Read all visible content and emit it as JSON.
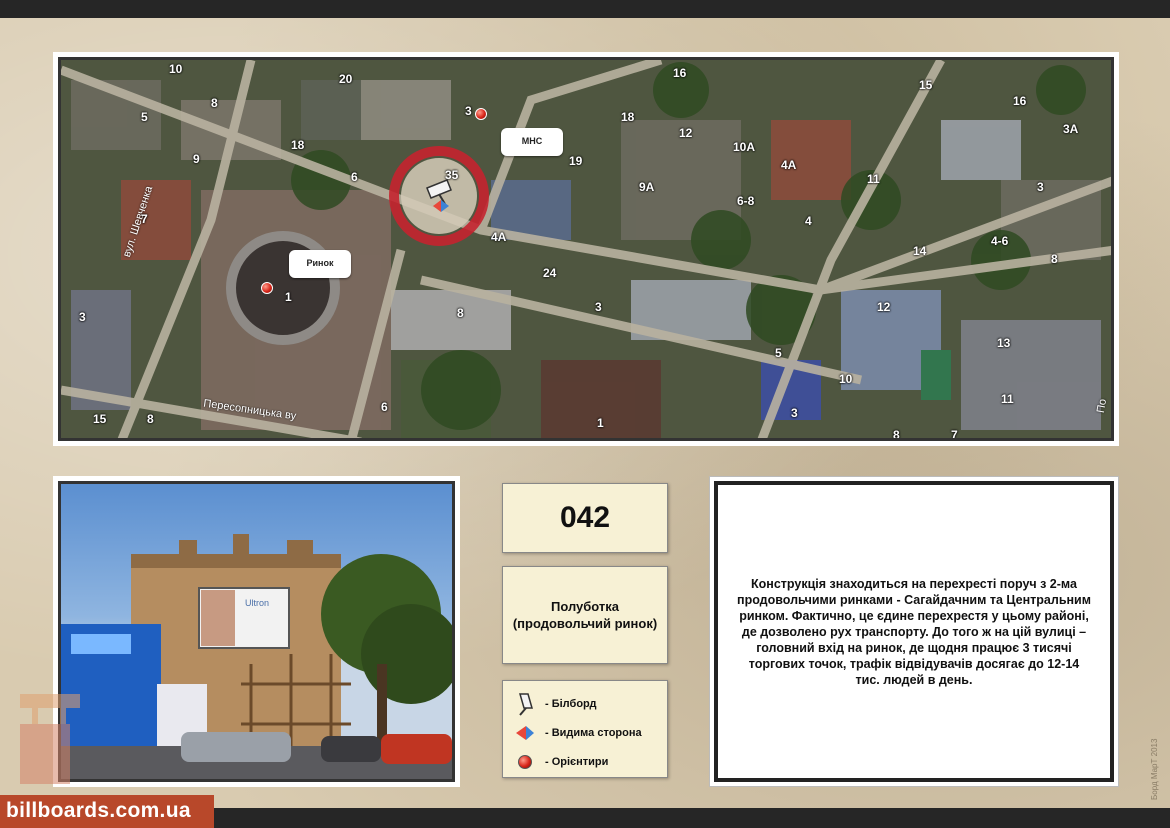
{
  "header": {},
  "map": {
    "callouts": {
      "mns": "МНС",
      "market": "Ринок"
    },
    "streets": {
      "shevchenka": "вул. Шевченка",
      "peresopnytska": "Пересопницька ву",
      "right_edge": "По"
    },
    "house_numbers": [
      "10",
      "20",
      "8",
      "5",
      "9",
      "18",
      "6",
      "7",
      "3",
      "15",
      "8",
      "6",
      "1",
      "3",
      "4А",
      "35",
      "19",
      "18",
      "12",
      "16",
      "10А",
      "9А",
      "4А",
      "6-8",
      "4",
      "11",
      "24",
      "8",
      "5",
      "1",
      "3",
      "10",
      "8",
      "7",
      "14",
      "12",
      "4-6",
      "8",
      "13",
      "11",
      "3",
      "3А",
      "16",
      "15",
      "3"
    ]
  },
  "photo": {
    "billboard_brand": "Ultron"
  },
  "info": {
    "code": "042",
    "name_line1": "Полуботка",
    "name_line2": "(продовольчий ринок)"
  },
  "legend": {
    "items": [
      {
        "icon": "billboard-icon",
        "label": "- Білборд"
      },
      {
        "icon": "visible-side-icon",
        "label": "- Видима сторона"
      },
      {
        "icon": "landmark-pin-icon",
        "label": "- Орієнтири"
      }
    ]
  },
  "description": "Конструкція знаходиться на перехресті поруч з 2-ма продовольчими ринками - Сагайдачним та Центральним ринком. Фактично, це єдине перехрестя у цьому районі, де дозволено рух транспорту. До того ж на цій вулиці – головний вхід на ринок, де щодня працює 3 тисячі торгових точок, трафік відвідувачів досягає до 12-14 тис. людей в день.",
  "footer": {
    "brand": "billboards.com.ua",
    "credit": "Борд МарТ 2013"
  },
  "colors": {
    "accent": "#b8482a",
    "frame_border": "#333333",
    "box_fill": "#f7f1d5",
    "pin_red": "#d8261a"
  }
}
